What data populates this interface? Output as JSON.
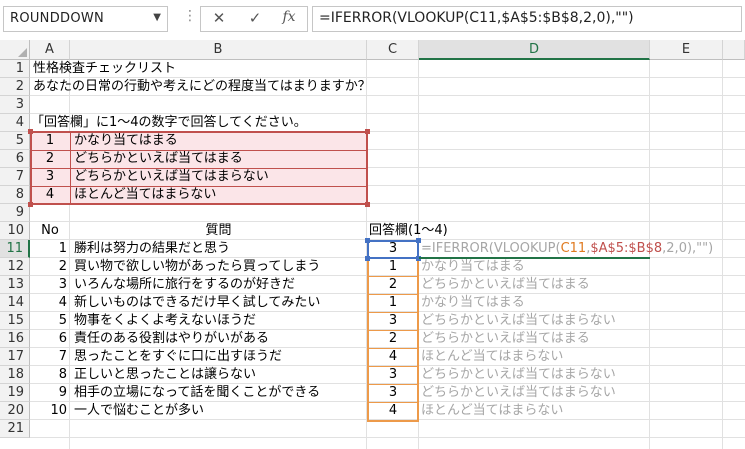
{
  "formula_bar": {
    "name_box": "ROUNDDOWN",
    "cancel_symbol": "✕",
    "enter_symbol": "✓",
    "fx_symbol": "fx",
    "formula": "=IFERROR(VLOOKUP(C11,$A$5:$B$8,2,0),\"\")"
  },
  "columns": [
    "A",
    "B",
    "C",
    "D",
    "E"
  ],
  "rows": [
    "1",
    "2",
    "3",
    "4",
    "5",
    "6",
    "7",
    "8",
    "9",
    "10",
    "11",
    "12",
    "13",
    "14",
    "15",
    "16",
    "17",
    "18",
    "19",
    "20",
    "21"
  ],
  "sheet": {
    "title": "性格検査チェックリスト",
    "question": "あなたの日常の行動や考えにどの程度当てはまりますか？",
    "instruction": "「回答欄」に1～4の数字で回答してください。",
    "legend": [
      {
        "num": "1",
        "text": "かなり当てはまる"
      },
      {
        "num": "2",
        "text": "どちらかといえば当てはまる"
      },
      {
        "num": "3",
        "text": "どちらかといえば当てはまらない"
      },
      {
        "num": "4",
        "text": "ほとんど当てはまらない"
      }
    ],
    "header_no": "No",
    "header_question": "質問",
    "header_answer": "回答欄(1～4)",
    "items": [
      {
        "no": "1",
        "q": "勝利は努力の結果だと思う",
        "a": "3",
        "r": ""
      },
      {
        "no": "2",
        "q": "買い物で欲しい物があったら買ってしまう",
        "a": "1",
        "r": "かなり当てはまる"
      },
      {
        "no": "3",
        "q": "いろんな場所に旅行をするのが好きだ",
        "a": "2",
        "r": "どちらかといえば当てはまる"
      },
      {
        "no": "4",
        "q": "新しいものはできるだけ早く試してみたい",
        "a": "1",
        "r": "かなり当てはまる"
      },
      {
        "no": "5",
        "q": "物事をくよくよ考えないほうだ",
        "a": "3",
        "r": "どちらかといえば当てはまらない"
      },
      {
        "no": "6",
        "q": "責任のある役割はやりがいがある",
        "a": "2",
        "r": "どちらかといえば当てはまる"
      },
      {
        "no": "7",
        "q": "思ったことをすぐに口に出すほうだ",
        "a": "4",
        "r": "ほとんど当てはまらない"
      },
      {
        "no": "8",
        "q": "正しいと思ったことは譲らない",
        "a": "3",
        "r": "どちらかといえば当てはまらない"
      },
      {
        "no": "9",
        "q": "相手の立場になって話を聞くことができる",
        "a": "3",
        "r": "どちらかといえば当てはまらない"
      },
      {
        "no": "10",
        "q": "一人で悩むことが多い",
        "a": "4",
        "r": "ほとんど当てはまらない"
      }
    ],
    "edit_formula": {
      "p1": "=IFERROR(VLOOKUP(",
      "p2": "C11",
      "p3": ",",
      "p4": "$A$5:$B$8",
      "p5": ",2,0),\"\")"
    }
  },
  "colors": {
    "accent": "#217346",
    "range_pink": "#c0504d",
    "range_orange": "#ed9a4a",
    "range_blue": "#4472c4"
  }
}
